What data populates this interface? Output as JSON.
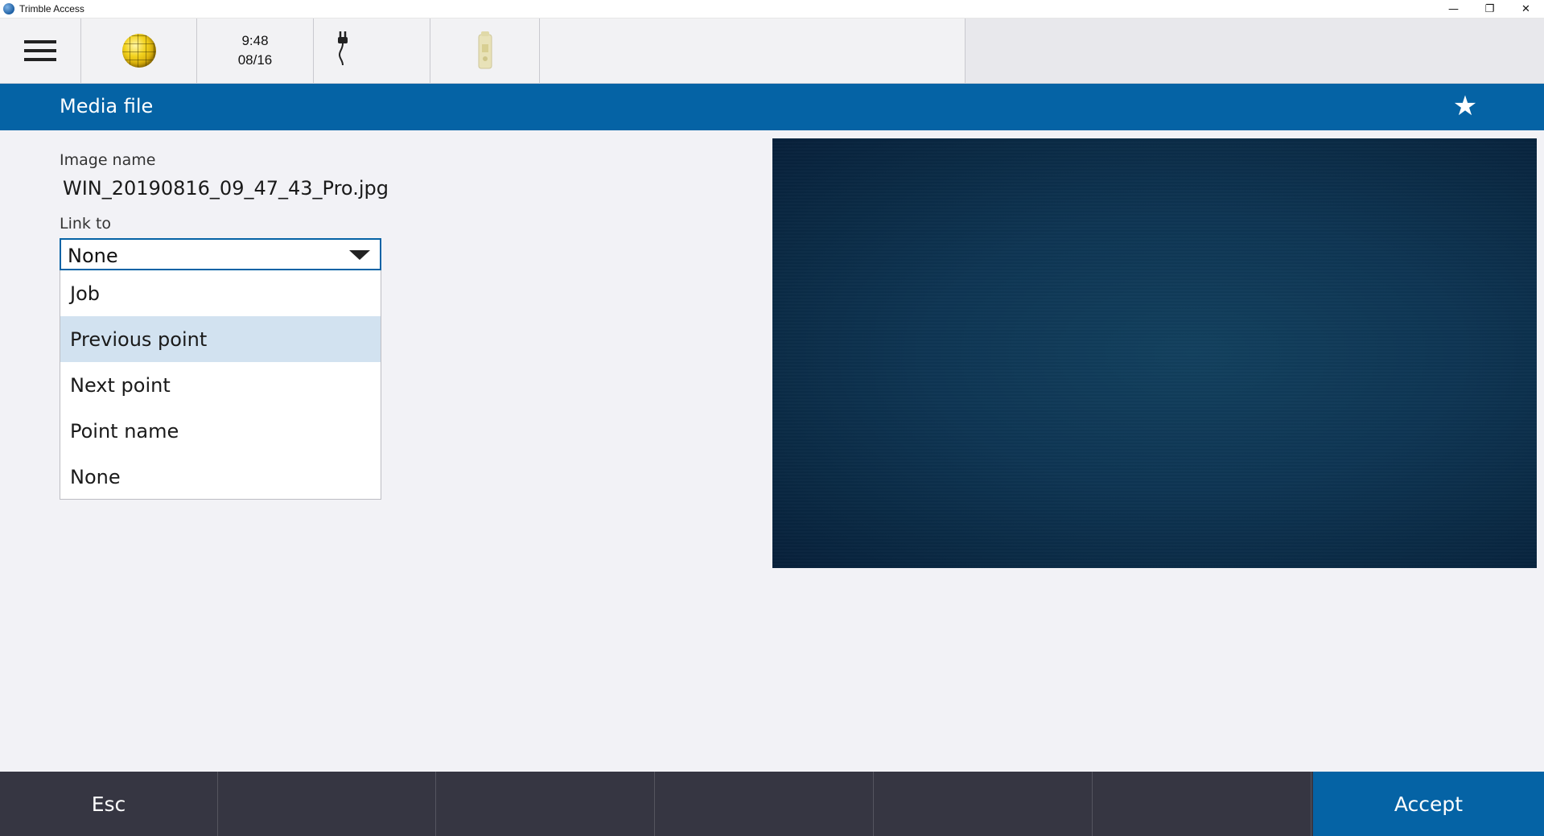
{
  "window": {
    "title": "Trimble Access",
    "controls": {
      "minimize": "—",
      "restore": "❐",
      "close": "✕"
    }
  },
  "statusbar": {
    "time": "9:48",
    "date": "08/16",
    "icons": [
      "menu-icon",
      "globe-icon",
      "power-plug-icon",
      "receiver-icon"
    ]
  },
  "header": {
    "title": "Media file",
    "favorite_icon": "★"
  },
  "form": {
    "image_name_label": "Image name",
    "image_name_value": "WIN_20190816_09_47_43_Pro.jpg",
    "link_to_label": "Link to",
    "link_to_value": "None",
    "link_to_options": [
      "Job",
      "Previous point",
      "Next point",
      "Point name",
      "None"
    ],
    "highlighted_option": "Previous point"
  },
  "softkeys": {
    "esc": "Esc",
    "accept": "Accept"
  },
  "colors": {
    "accent": "#0563a5",
    "softkey_bg": "#363642",
    "highlight": "#d2e2f0",
    "background": "#f2f2f6"
  }
}
